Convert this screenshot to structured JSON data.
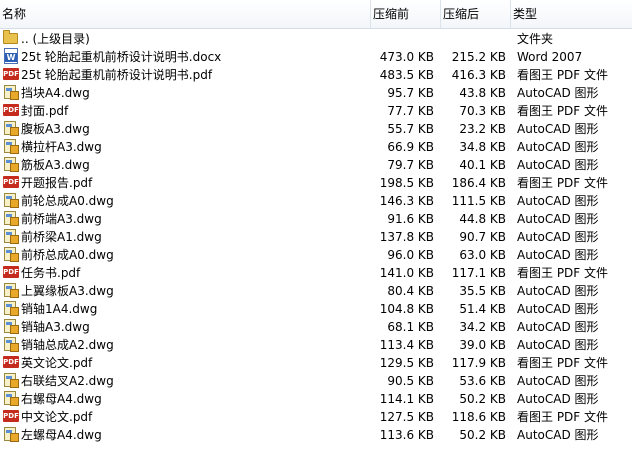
{
  "columns": {
    "name": "名称",
    "original": "压缩前",
    "compressed": "压缩后",
    "type": "类型"
  },
  "files": [
    {
      "icon": "folder-icon",
      "name": ".. (上级目录)",
      "original": "",
      "compressed": "",
      "type": "文件夹"
    },
    {
      "icon": "word-doc-icon",
      "name": "25t 轮胎起重机前桥设计说明书.docx",
      "original": "473.0 KB",
      "compressed": "215.2 KB",
      "type": "Word 2007"
    },
    {
      "icon": "pdf-icon",
      "name": "25t 轮胎起重机前桥设计说明书.pdf",
      "original": "483.5 KB",
      "compressed": "416.3 KB",
      "type": "看图王 PDF 文件"
    },
    {
      "icon": "autocad-icon",
      "name": "挡块A4.dwg",
      "original": "95.7 KB",
      "compressed": "43.8 KB",
      "type": "AutoCAD 图形"
    },
    {
      "icon": "pdf-icon",
      "name": "封面.pdf",
      "original": "77.7 KB",
      "compressed": "70.3 KB",
      "type": "看图王 PDF 文件"
    },
    {
      "icon": "autocad-icon",
      "name": "腹板A3.dwg",
      "original": "55.7 KB",
      "compressed": "23.2 KB",
      "type": "AutoCAD 图形"
    },
    {
      "icon": "autocad-icon",
      "name": "横拉杆A3.dwg",
      "original": "66.9 KB",
      "compressed": "34.8 KB",
      "type": "AutoCAD 图形"
    },
    {
      "icon": "autocad-icon",
      "name": "筋板A3.dwg",
      "original": "79.7 KB",
      "compressed": "40.1 KB",
      "type": "AutoCAD 图形"
    },
    {
      "icon": "pdf-icon",
      "name": "开题报告.pdf",
      "original": "198.5 KB",
      "compressed": "186.4 KB",
      "type": "看图王 PDF 文件"
    },
    {
      "icon": "autocad-icon",
      "name": "前轮总成A0.dwg",
      "original": "146.3 KB",
      "compressed": "111.5 KB",
      "type": "AutoCAD 图形"
    },
    {
      "icon": "autocad-icon",
      "name": "前桥端A3.dwg",
      "original": "91.6 KB",
      "compressed": "44.8 KB",
      "type": "AutoCAD 图形"
    },
    {
      "icon": "autocad-icon",
      "name": "前桥梁A1.dwg",
      "original": "137.8 KB",
      "compressed": "90.7 KB",
      "type": "AutoCAD 图形"
    },
    {
      "icon": "autocad-icon",
      "name": "前桥总成A0.dwg",
      "original": "96.0 KB",
      "compressed": "63.0 KB",
      "type": "AutoCAD 图形"
    },
    {
      "icon": "pdf-icon",
      "name": "任务书.pdf",
      "original": "141.0 KB",
      "compressed": "117.1 KB",
      "type": "看图王 PDF 文件"
    },
    {
      "icon": "autocad-icon",
      "name": "上翼缘板A3.dwg",
      "original": "80.4 KB",
      "compressed": "35.5 KB",
      "type": "AutoCAD 图形"
    },
    {
      "icon": "autocad-icon",
      "name": "销轴1A4.dwg",
      "original": "104.8 KB",
      "compressed": "51.4 KB",
      "type": "AutoCAD 图形"
    },
    {
      "icon": "autocad-icon",
      "name": "销轴A3.dwg",
      "original": "68.1 KB",
      "compressed": "34.2 KB",
      "type": "AutoCAD 图形"
    },
    {
      "icon": "autocad-icon",
      "name": "销轴总成A2.dwg",
      "original": "113.4 KB",
      "compressed": "39.0 KB",
      "type": "AutoCAD 图形"
    },
    {
      "icon": "pdf-icon",
      "name": "英文论文.pdf",
      "original": "129.5 KB",
      "compressed": "117.9 KB",
      "type": "看图王 PDF 文件"
    },
    {
      "icon": "autocad-icon",
      "name": "右联结叉A2.dwg",
      "original": "90.5 KB",
      "compressed": "53.6 KB",
      "type": "AutoCAD 图形"
    },
    {
      "icon": "autocad-icon",
      "name": "右螺母A4.dwg",
      "original": "114.1 KB",
      "compressed": "50.2 KB",
      "type": "AutoCAD 图形"
    },
    {
      "icon": "pdf-icon",
      "name": "中文论文.pdf",
      "original": "127.5 KB",
      "compressed": "118.6 KB",
      "type": "看图王 PDF 文件"
    },
    {
      "icon": "autocad-icon",
      "name": "左螺母A4.dwg",
      "original": "113.6 KB",
      "compressed": "50.2 KB",
      "type": "AutoCAD 图形"
    }
  ]
}
